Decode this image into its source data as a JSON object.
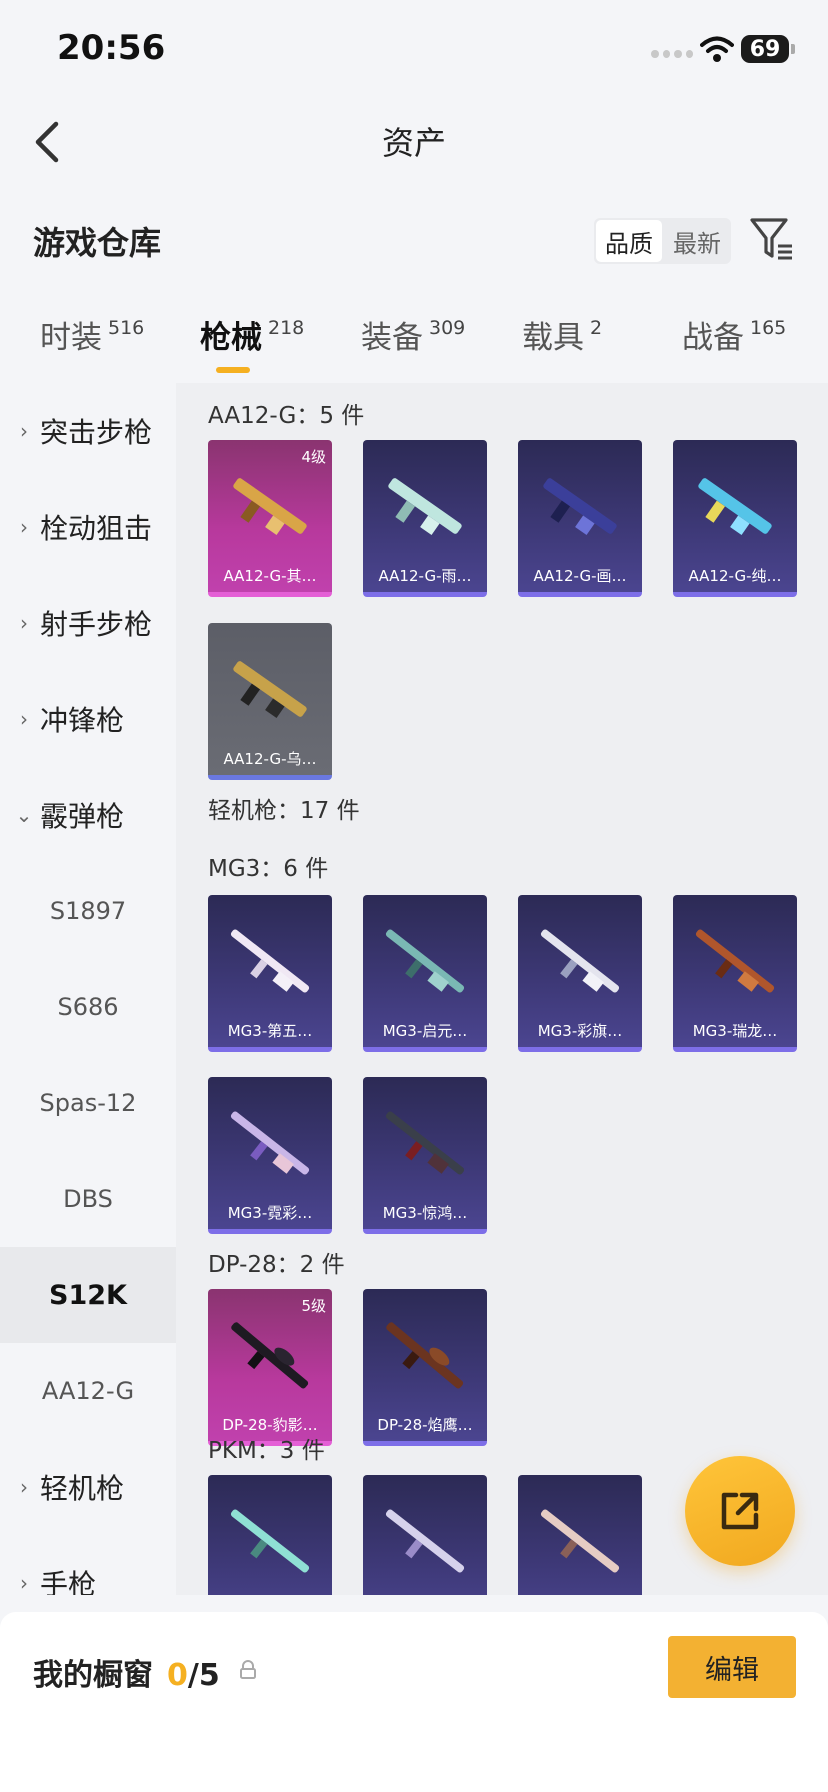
{
  "status_bar": {
    "time": "20:56",
    "battery": "69"
  },
  "nav": {
    "title": "资产"
  },
  "warehouse": {
    "title": "游戏仓库",
    "sort_quality": "品质",
    "sort_newest": "最新"
  },
  "tabs": [
    {
      "label": "时装",
      "count": "516"
    },
    {
      "label": "枪械",
      "count": "218"
    },
    {
      "label": "装备",
      "count": "309"
    },
    {
      "label": "载具",
      "count": "2"
    },
    {
      "label": "战备",
      "count": "165"
    }
  ],
  "sidebar": {
    "assault": "突击步枪",
    "bolt": "栓动狙击",
    "marksman": "射手步枪",
    "smg": "冲锋枪",
    "shotgun": "霰弹枪",
    "s1897": "S1897",
    "s686": "S686",
    "spas": "Spas-12",
    "dbs": "DBS",
    "s12k": "S12K",
    "aa12g": "AA12-G",
    "lmg": "轻机枪",
    "pistol": "手枪"
  },
  "sections": {
    "aa12g": "AA12-G：5 件",
    "lmg": "轻机枪：17 件",
    "mg3": "MG3：6 件",
    "dp28": "DP-28：2 件",
    "pkm": "PKM：3 件"
  },
  "cards": {
    "aa1": {
      "name": "AA12-G-其…",
      "level": "4级"
    },
    "aa2": {
      "name": "AA12-G-雨…"
    },
    "aa3": {
      "name": "AA12-G-画…"
    },
    "aa4": {
      "name": "AA12-G-纯…"
    },
    "aa5": {
      "name": "AA12-G-乌…"
    },
    "mg1": {
      "name": "MG3-第五…"
    },
    "mg2": {
      "name": "MG3-启元…"
    },
    "mg3": {
      "name": "MG3-彩旗…"
    },
    "mg4": {
      "name": "MG3-瑞龙…"
    },
    "mg5": {
      "name": "MG3-霓彩…"
    },
    "mg6": {
      "name": "MG3-惊鸿…"
    },
    "dp1": {
      "name": "DP-28-豹影…",
      "level": "5级"
    },
    "dp2": {
      "name": "DP-28-焰鹰…"
    }
  },
  "bottom": {
    "label": "我的橱窗",
    "current": "0",
    "total": "/5",
    "edit": "编辑"
  },
  "colors": {
    "accent": "#f5b021",
    "epic": "#c041ad",
    "rare": "#4b4590"
  }
}
